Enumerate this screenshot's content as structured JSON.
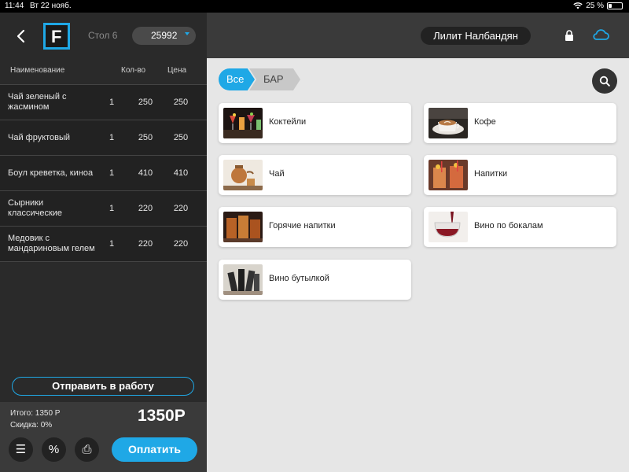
{
  "status_bar": {
    "time": "11:44",
    "date": "Вт 22 нояб.",
    "battery": "25 %"
  },
  "left_header": {
    "table": "Стол 6",
    "order_number": "25992",
    "logo_letter": "F"
  },
  "order_table": {
    "headers": {
      "name": "Наименование",
      "qty": "Кол-во",
      "price": "Цена"
    },
    "rows": [
      {
        "name": "Чай зеленый с жасмином",
        "qty": "1",
        "price": "250",
        "sum": "250"
      },
      {
        "name": "Чай фруктовый",
        "qty": "1",
        "price": "250",
        "sum": "250"
      },
      {
        "name": "Боул креветка, киноа",
        "qty": "1",
        "price": "410",
        "sum": "410"
      },
      {
        "name": "Сырники классические",
        "qty": "1",
        "price": "220",
        "sum": "220"
      },
      {
        "name": "Медовик с мандариновым гелем",
        "qty": "1",
        "price": "220",
        "sum": "220"
      }
    ]
  },
  "actions": {
    "send_label": "Отправить в работу",
    "total_label": "Итого: 1350 Р",
    "discount_label": "Скидка: 0%",
    "total_big": "1350Р",
    "pay_label": "Оплатить",
    "menu_glyph": "☰",
    "percent_glyph": "%",
    "print_glyph": "⎙"
  },
  "topbar": {
    "user_name": "Лилит Налбандян"
  },
  "breadcrumb": {
    "all": "Все",
    "current": "БАР"
  },
  "categories": [
    {
      "label": "Коктейли",
      "thumb": "cocktails"
    },
    {
      "label": "Кофе",
      "thumb": "coffee"
    },
    {
      "label": "Чай",
      "thumb": "tea"
    },
    {
      "label": "Напитки",
      "thumb": "drinks"
    },
    {
      "label": "Горячие напитки",
      "thumb": "hot-drinks"
    },
    {
      "label": "Вино по бокалам",
      "thumb": "wine-glass"
    },
    {
      "label": "Вино бутылкой",
      "thumb": "wine-bottle"
    }
  ],
  "colors": {
    "accent": "#1fa8e6",
    "panel_dark": "#2a2a2a",
    "topbar": "#3a3a3a",
    "main_bg": "#e6e6e6"
  }
}
